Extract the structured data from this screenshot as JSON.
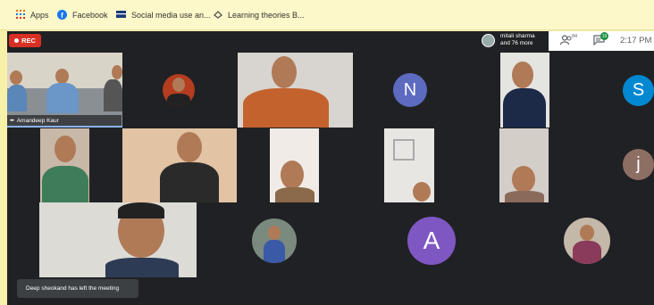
{
  "bookmarks": [
    {
      "label": "Apps",
      "icon": "apps-grid-icon"
    },
    {
      "label": "Facebook",
      "icon": "facebook-icon"
    },
    {
      "label": "Social media use an...",
      "icon": "bookmark-favicon-icon"
    },
    {
      "label": "Learning theories B...",
      "icon": "bookmark-favicon-icon"
    }
  ],
  "meeting": {
    "rec_label": "REC",
    "participants_name": "mitali sharma",
    "participants_more": "and 76 more",
    "people_count": "84",
    "chat_count": "19",
    "clock": "2:17 PM"
  },
  "tiles": {
    "pinned_name": "Amandeep Kaur",
    "avatar_n": "N",
    "avatar_s": "S",
    "avatar_j": "j",
    "avatar_a": "A"
  },
  "toast": "Deep sheokand has left the meeting",
  "colors": {
    "meet_bg": "#202124",
    "tile_bg": "#3c4043",
    "rec": "#d93025",
    "avatar_n": "#5c6bc0",
    "avatar_s": "#0288d1",
    "avatar_j": "#8d6e63",
    "avatar_a": "#7e57c2",
    "chat_badge": "#1e8e3e"
  }
}
